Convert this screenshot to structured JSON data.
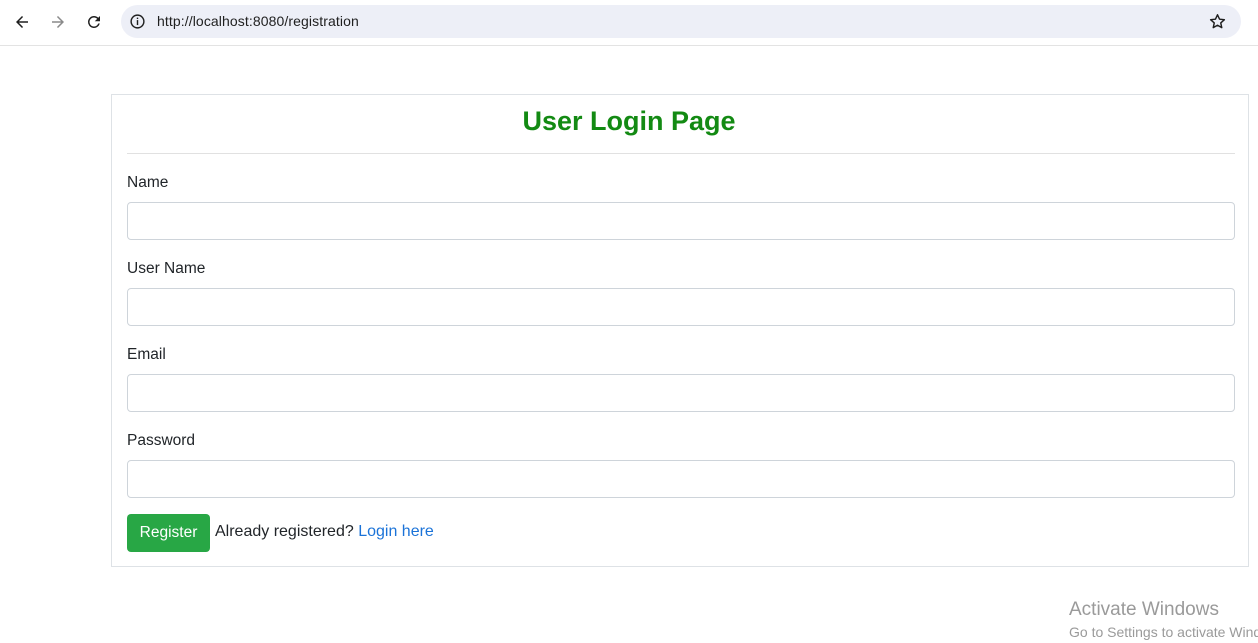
{
  "browser": {
    "url": "http://localhost:8080/registration",
    "back_icon": "arrow-left-icon",
    "forward_icon": "arrow-right-icon",
    "reload_icon": "reload-icon",
    "site_info_icon": "info-icon",
    "bookmark_icon": "star-icon"
  },
  "form": {
    "title": "User Login Page",
    "title_color": "#138a13",
    "fields": [
      {
        "label": "Name",
        "value": "",
        "type": "text"
      },
      {
        "label": "User Name",
        "value": "",
        "type": "text"
      },
      {
        "label": "Email",
        "value": "",
        "type": "email"
      },
      {
        "label": "Password",
        "value": "",
        "type": "password"
      }
    ],
    "register_label": "Register",
    "register_color": "#28a745",
    "already_text": "Already registered?",
    "login_link_text": "Login here",
    "link_color": "#1b73d8"
  },
  "watermark": {
    "title": "Activate Windows",
    "subtitle": "Go to Settings to activate Windows."
  }
}
